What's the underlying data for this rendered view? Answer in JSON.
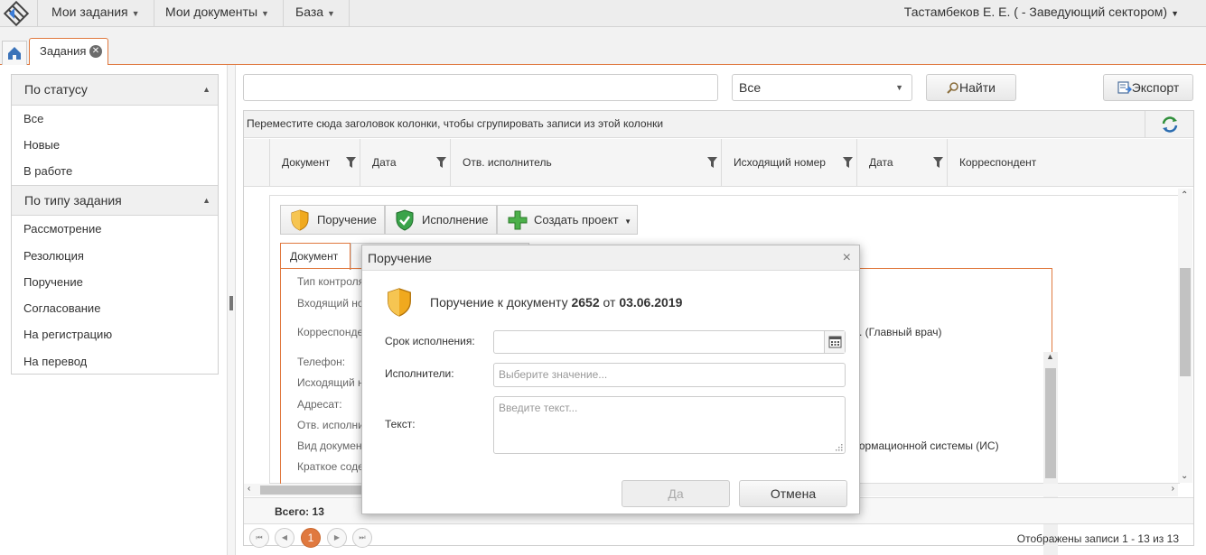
{
  "topbar": {
    "menu": [
      {
        "label": "Мои задания"
      },
      {
        "label": "Мои документы"
      },
      {
        "label": "База"
      }
    ],
    "user": "Тастамбеков Е. Е. ( - Заведующий сектором)"
  },
  "tabs": {
    "active_label": "Задания"
  },
  "left_panel": {
    "status_group": {
      "title": "По статусу",
      "items": [
        "Все",
        "Новые",
        "В работе"
      ]
    },
    "type_group": {
      "title": "По типу задания",
      "items": [
        "Рассмотрение",
        "Резолюция",
        "Поручение",
        "Согласование",
        "На регистрацию",
        "На перевод"
      ]
    }
  },
  "toolbar": {
    "search_value": "",
    "filter_value": "Все",
    "find_label": "Найти",
    "export_label": "Экспорт"
  },
  "grid": {
    "group_hint": "Переместите сюда заголовок колонки, чтобы сгрупировать записи из этой колонки",
    "columns": [
      "Документ",
      "Дата",
      "Отв. исполнитель",
      "Исходящий номер",
      "Дата",
      "Корреспондент"
    ],
    "total": "Всего: 13",
    "records_info": "Отображены записи 1 - 13 из 13",
    "current_page": "1"
  },
  "detail": {
    "buttons": {
      "order": "Поручение",
      "execution": "Исполнение",
      "create_project": "Создать проект"
    },
    "tab_document": "Документ",
    "labels": [
      "Тип контроля",
      "Входящий но",
      "Корреспонде",
      "Телефон:",
      "Исходящий н",
      "Адресат:",
      "Отв. исполни",
      "Вид докумен",
      "Краткое соде"
    ],
    "visible_values": {
      "correspondent": "М. (Главный врач)",
      "doc_type": "формационной системы (ИС)"
    }
  },
  "dialog": {
    "title": "Поручение",
    "message_prefix": "Поручение к документу",
    "doc_number": "2652",
    "message_mid": "от",
    "doc_date": "03.06.2019",
    "deadline_label": "Срок исполнения:",
    "deadline_value": "",
    "executors_label": "Исполнители:",
    "executors_placeholder": "Выберите значение...",
    "text_label": "Текст:",
    "text_placeholder": "Введите текст...",
    "yes_label": "Да",
    "cancel_label": "Отмена"
  },
  "colors": {
    "accent": "#e0793f",
    "shield_gold": "#f0a91e",
    "shield_green": "#3aa34a"
  }
}
